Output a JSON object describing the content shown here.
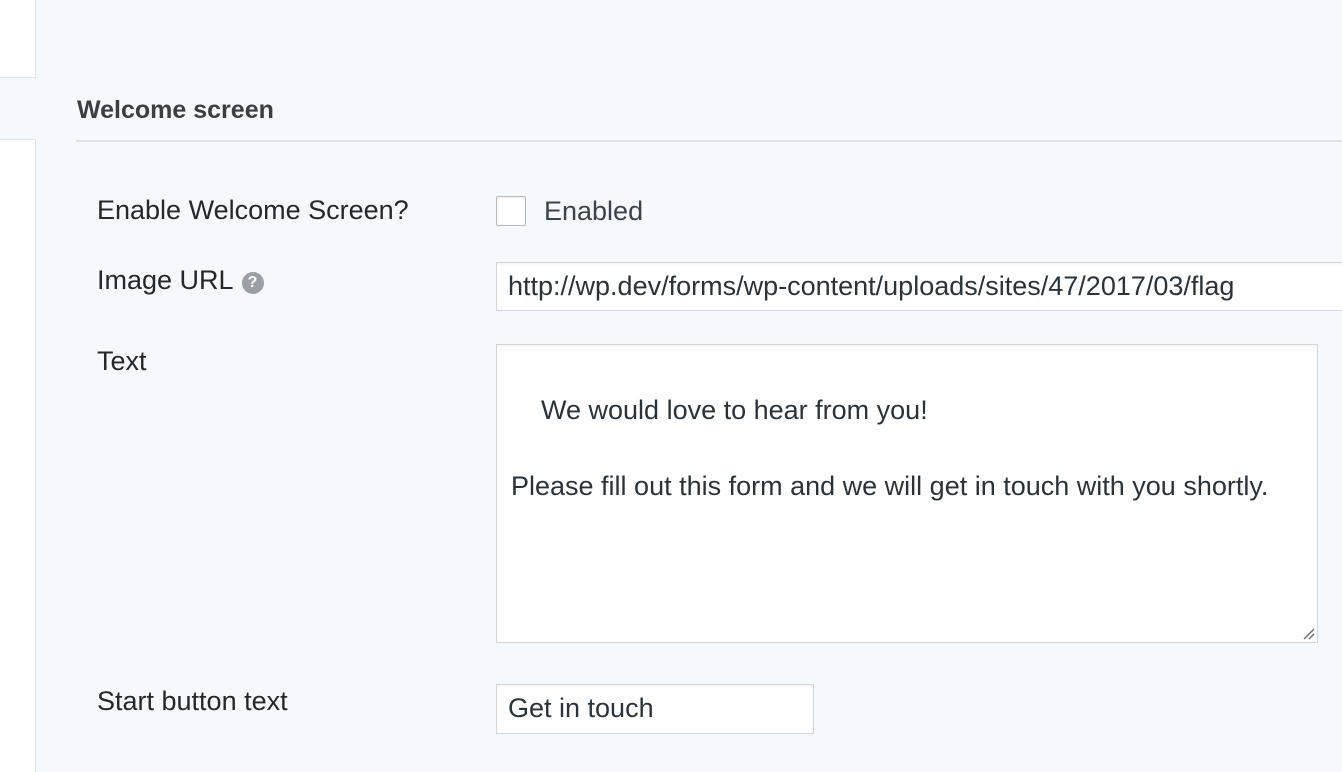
{
  "section": {
    "title": "Welcome screen"
  },
  "fields": {
    "enable": {
      "label": "Enable Welcome Screen?",
      "checkbox_label": "Enabled",
      "checked": false
    },
    "image_url": {
      "label": "Image URL",
      "help_icon": "question-circle-icon",
      "value": "http://wp.dev/forms/wp-content/uploads/sites/47/2017/03/flag"
    },
    "text": {
      "label": "Text",
      "value": "We would love to hear from you!\n\nPlease fill out this form and we will get in touch with you shortly."
    },
    "start_button": {
      "label": "Start button text",
      "value": "Get in touch"
    }
  },
  "colors": {
    "background": "#f5f9fc",
    "help_icon": "#9aa0a6",
    "border": "#d4d6d9"
  }
}
